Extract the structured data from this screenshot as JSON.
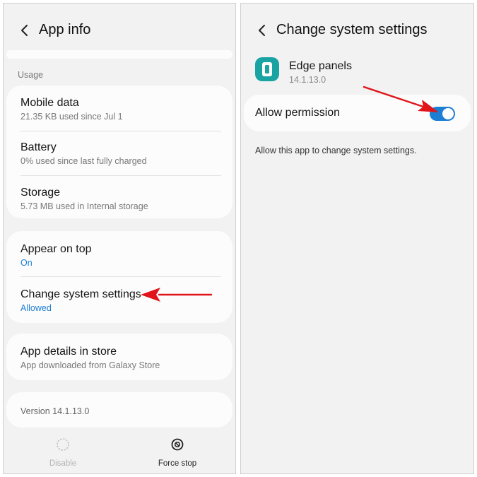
{
  "left": {
    "header": {
      "title": "App info"
    },
    "section_label": "Usage",
    "usage_items": [
      {
        "title": "Mobile data",
        "sub": "21.35 KB used since Jul 1"
      },
      {
        "title": "Battery",
        "sub": "0% used since last fully charged"
      },
      {
        "title": "Storage",
        "sub": "5.73 MB used in Internal storage"
      }
    ],
    "advanced_items": [
      {
        "title": "Appear on top",
        "sub": "On"
      },
      {
        "title": "Change system settings",
        "sub": "Allowed"
      }
    ],
    "store_item": {
      "title": "App details in store",
      "sub": "App downloaded from Galaxy Store"
    },
    "version": "Version 14.1.13.0",
    "bottom": {
      "disable_label": "Disable",
      "force_stop_label": "Force stop"
    }
  },
  "right": {
    "header": {
      "title": "Change system settings"
    },
    "app": {
      "name": "Edge panels",
      "version": "14.1.13.0"
    },
    "permission": {
      "label": "Allow permission",
      "enabled": true
    },
    "description": "Allow this app to change system settings."
  },
  "colors": {
    "accent": "#1d7fd4",
    "arrow": "#e0141a",
    "app_icon": "#1aa3a3",
    "background": "#f2f2f2"
  },
  "icons": [
    "back-arrow-icon",
    "disable-icon",
    "force-stop-icon",
    "edge-panels-app-icon"
  ]
}
